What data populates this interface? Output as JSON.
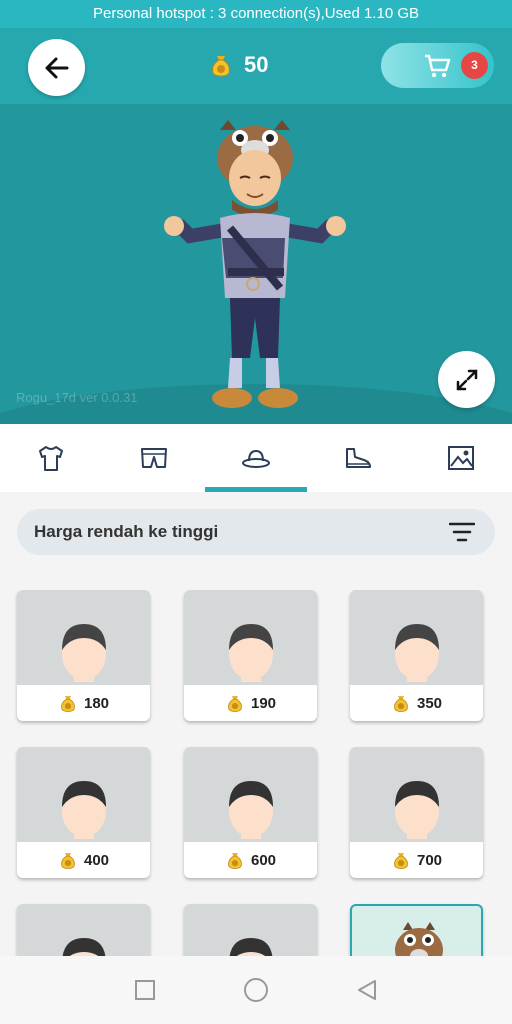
{
  "status_bar": {
    "text": "Personal hotspot : 3 connection(s),Used  1.10 GB"
  },
  "header": {
    "coins": "50",
    "cart_count": "3"
  },
  "hero": {
    "version": "Rogu_17d ver 0.0.31"
  },
  "tabs": [
    {
      "name": "shirt-icon"
    },
    {
      "name": "pants-icon"
    },
    {
      "name": "hat-icon",
      "active": true
    },
    {
      "name": "shoe-icon"
    },
    {
      "name": "image-icon"
    }
  ],
  "sort": {
    "label": "Harga rendah ke tinggi"
  },
  "items": [
    {
      "price": "180",
      "hair": "#444"
    },
    {
      "price": "190",
      "hair": "#444"
    },
    {
      "price": "350",
      "hair": "#444"
    },
    {
      "price": "400",
      "hair": "#333"
    },
    {
      "price": "600",
      "hair": "#333"
    },
    {
      "price": "700",
      "hair": "#333"
    },
    {
      "price": "",
      "hair": "#333"
    },
    {
      "price": "",
      "hair": "#333"
    },
    {
      "price": "",
      "hair": "horse"
    }
  ],
  "colors": {
    "accent": "#29a9b2",
    "hero_bg": "#23979e",
    "badge": "#e84545"
  }
}
